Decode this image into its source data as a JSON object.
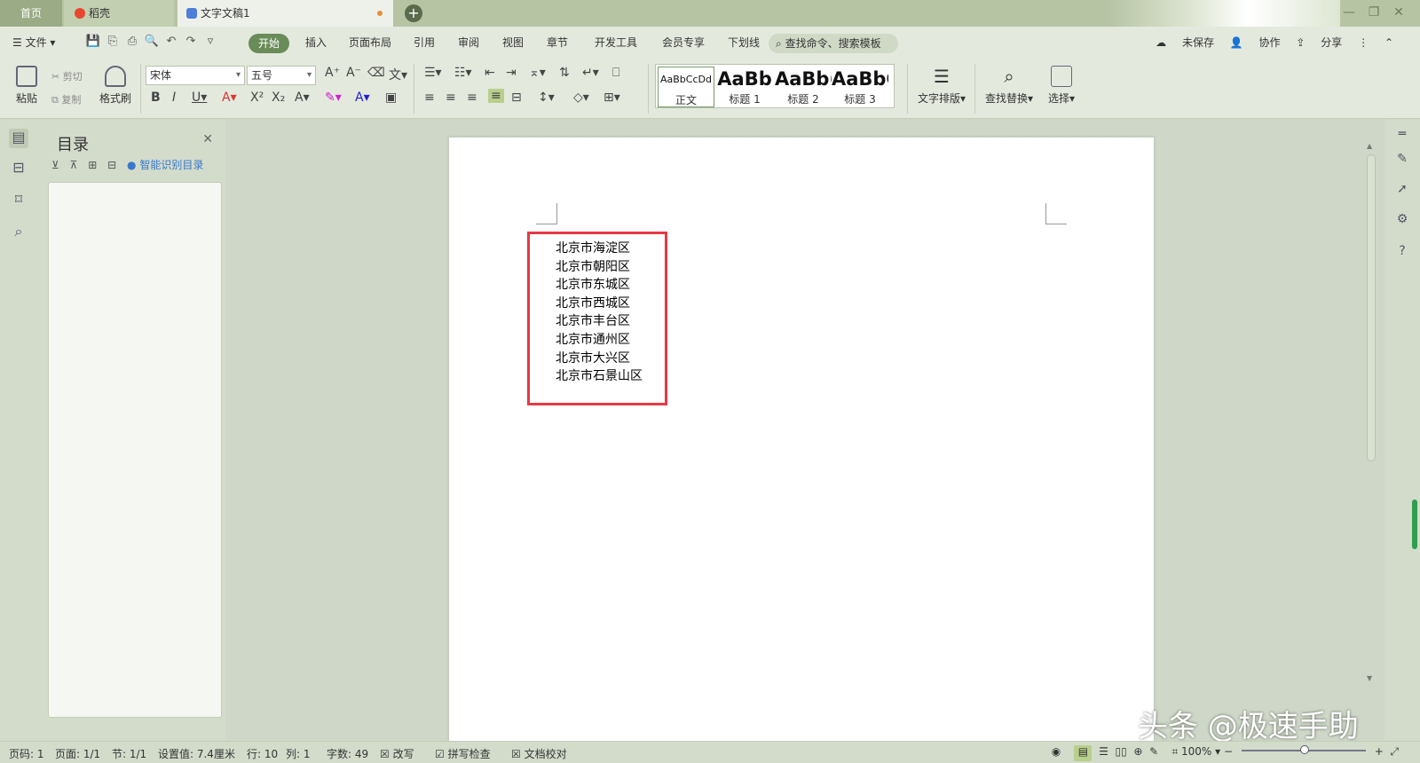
{
  "tabs": {
    "home": "首页",
    "daoke": "稻壳",
    "doc": "文字文稿1"
  },
  "menu": {
    "file": "文件",
    "start": "开始",
    "items": [
      "插入",
      "页面布局",
      "引用",
      "审阅",
      "视图",
      "章节",
      "开发工具",
      "会员专享",
      "下划线"
    ],
    "search": "查找命令、搜索模板",
    "unsaved": "未保存",
    "collab": "协作",
    "share": "分享"
  },
  "ribbon": {
    "paste": "粘贴",
    "cut": "剪切",
    "copy": "复制",
    "format_painter": "格式刷",
    "font_name": "宋体",
    "font_size": "五号",
    "styles": [
      {
        "sample": "AaBbCcDd",
        "name": "正文"
      },
      {
        "sample": "AaBb",
        "name": "标题 1"
      },
      {
        "sample": "AaBb(",
        "name": "标题 2"
      },
      {
        "sample": "AaBbC",
        "name": "标题 3"
      }
    ],
    "text_layout": "文字排版",
    "find_replace": "查找替换",
    "select": "选择"
  },
  "toc": {
    "title": "目录",
    "smart": "智能识别目录"
  },
  "document": {
    "lines": [
      "北京市海淀区",
      "北京市朝阳区",
      "北京市东城区",
      "北京市西城区",
      "北京市丰台区",
      "北京市通州区",
      "北京市大兴区",
      "北京市石景山区"
    ]
  },
  "status": {
    "page": "页码: 1",
    "pages": "页面: 1/1",
    "section": "节: 1/1",
    "setting": "设置值: 7.4厘米",
    "row": "行: 10",
    "col": "列: 1",
    "words": "字数: 49",
    "revise": "改写",
    "spell": "拼写检查",
    "proof": "文档校对",
    "zoom": "100%"
  },
  "watermark": "头条 @极速手助",
  "colors": {
    "accent": "#6a8c59",
    "highlight": "#e63946"
  }
}
